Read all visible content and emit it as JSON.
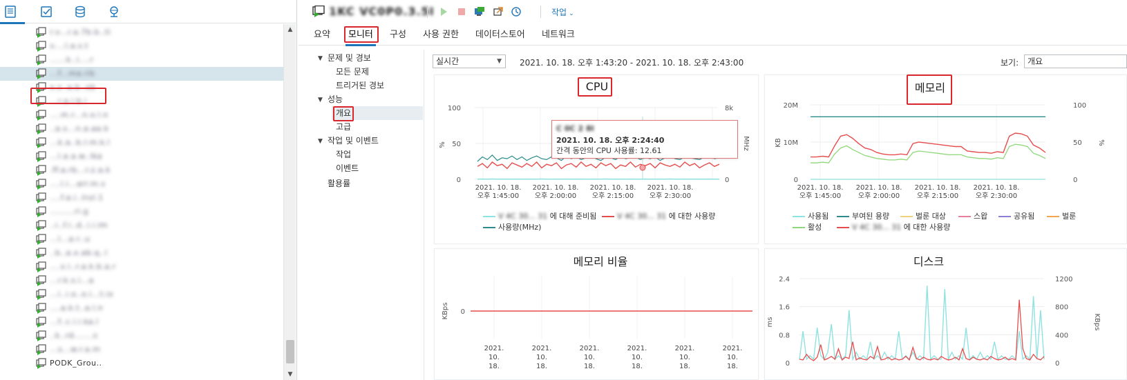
{
  "left_tabs": [
    {
      "name": "hosts-and-clusters",
      "icon": "hosts-clusters-icon"
    },
    {
      "name": "vms-and-templates",
      "icon": "vms-templates-icon"
    },
    {
      "name": "storage",
      "icon": "storage-icon"
    },
    {
      "name": "networking",
      "icon": "networking-icon"
    }
  ],
  "tree": {
    "items": [
      {
        "label": "r.v...r.a.7b.b..ti"
      },
      {
        "label": "v....l.a.s.t"
      },
      {
        "label": "......k..i....r"
      },
      {
        "label": "...f...ma.rik"
      },
      {
        "label": "x.z..a.b..ob"
      },
      {
        "label": "...r.a.i.b.i"
      },
      {
        "label": "....m.r...n.o.l.n"
      },
      {
        "label": "..a.s...n.a.aa.k"
      },
      {
        "label": "...k.a..b.r.m.k.l"
      },
      {
        "label": "...l.a.a.w..lka"
      },
      {
        "label": ".ff.a.rb...r.z.a.k"
      },
      {
        "label": "....l.i...arr.m.s"
      },
      {
        "label": "....f.a.i..lrul.1"
      },
      {
        "label": ".........ri.g"
      },
      {
        "label": "..i..f.i..d..i.i.im"
      },
      {
        "label": "...l...a.r..u"
      },
      {
        "label": "..b..a.x.ab.q..l"
      },
      {
        "label": "....s.i..r.a.k.b.a.r"
      },
      {
        "label": "...r.k.s.i...a"
      },
      {
        "label": "...i..i.o..o.i...t.ix"
      },
      {
        "label": "....a.k.t..a.l.n"
      },
      {
        "label": "...f..c.i.i.ka.l"
      },
      {
        "label": "..k..rd.......s"
      },
      {
        "label": "...s...w.r.a.m"
      },
      {
        "label": "PODK_Grou.."
      }
    ],
    "selected_index": 3
  },
  "header": {
    "vm_name": "1KC VC0P0.3.5I",
    "actions_label": "작업"
  },
  "tabs": [
    "요약",
    "모니터",
    "구성",
    "사용 권한",
    "데이터스토어",
    "네트워크"
  ],
  "active_tab": "모니터",
  "subnav": {
    "issues_label": "문제 및 경보",
    "all_issues": "모든 문제",
    "triggered_alarms": "트리거된 경보",
    "performance_label": "성능",
    "overview": "개요",
    "advanced": "고급",
    "tasks_events_label": "작업 및 이벤트",
    "tasks": "작업",
    "events": "이벤트",
    "utilization": "활용률"
  },
  "range": {
    "mode": "실시간",
    "text": "2021. 10. 18. 오후 1:43:20 - 2021. 10. 18. 오후 2:43:00",
    "view_label": "보기:",
    "view_value": "개요"
  },
  "colors": {
    "accent": "#1b75bb",
    "highlight_red": "#d9262c",
    "series_red": "#e74c4c",
    "series_teal": "#2a8c8c",
    "series_cyan": "#8ee2e0",
    "series_green": "#8fd879",
    "series_pink": "#f4a7b5",
    "series_purple": "#8a7fd6",
    "series_orange": "#f5a64a"
  },
  "tooltip": {
    "line1": "C 0C 2 8I",
    "line2": "2021. 10. 18. 오후 2:24:40",
    "line3": "간격 동안의 CPU 사용률: 12.61"
  },
  "charts": {
    "cpu": {
      "title": "CPU",
      "yleft_label": "%",
      "yright_label": "MHz",
      "yleft_ticks": [
        "100",
        "50",
        "0"
      ],
      "yright_ticks": [
        "8k",
        "4k",
        "0"
      ]
    },
    "memory": {
      "title": "메모리",
      "yleft_label": "KB",
      "yright_label": "%",
      "yleft_ticks": [
        "20M",
        "10M",
        "0"
      ],
      "yright_ticks": [
        "100",
        "50",
        "0"
      ]
    },
    "mem_rate": {
      "title": "메모리 비율",
      "yleft_label": "KBps",
      "yleft_ticks": [
        "0"
      ]
    },
    "disk": {
      "title": "디스크",
      "yleft_label": "ms",
      "yright_label": "KBps",
      "yleft_ticks": [
        "2.4",
        "1.6",
        "0.8",
        "0"
      ],
      "yright_ticks": [
        "1200",
        "800",
        "400",
        "0"
      ]
    }
  },
  "time_labels": [
    {
      "date": "2021. 10. 18.",
      "time": "오후 1:45:00"
    },
    {
      "date": "2021. 10. 18.",
      "time": "오후 2:00:00"
    },
    {
      "date": "2021. 10. 18.",
      "time": "오후 2:15:00"
    },
    {
      "date": "2021. 10. 18.",
      "time": "오후 2:30:00"
    }
  ],
  "bottom_time_labels": [
    "2021.",
    "10.",
    "18."
  ],
  "legend": {
    "cpu": [
      {
        "label": "V 4C 30... 31 에 대해 준비됨",
        "blur": "V 4C 30... 31",
        "suffix": "에 대해 준비됨",
        "color": "#8ee2e0"
      },
      {
        "label": "V 4C 30... 31 에 대한 사용량",
        "blur": "V 4C 30... 31",
        "suffix": "에 대한 사용량",
        "color": "#e74c4c"
      },
      {
        "label": "사용량(MHz)",
        "blur": "",
        "suffix": "사용량(MHz)",
        "color": "#2a8c8c"
      }
    ],
    "memory": [
      {
        "label": "사용됨",
        "color": "#8ee2e0"
      },
      {
        "label": "부여된 용량",
        "color": "#2a8c8c"
      },
      {
        "label": "벌룬 대상",
        "color": "#f0d278"
      },
      {
        "label": "스왑",
        "color": "#e87f9a"
      },
      {
        "label": "공유됨",
        "color": "#8a7fd6"
      },
      {
        "label": "벌룬",
        "color": "#f5a64a"
      },
      {
        "label": "활성",
        "color": "#8fd879"
      },
      {
        "label": "V 4C 30... 31 에 대한 사용량",
        "blur": "V 4C 30... 31",
        "suffix": "에 대한 사용량",
        "color": "#e74c4c"
      }
    ]
  },
  "chart_data": [
    {
      "type": "line",
      "title": "CPU",
      "xlabel": "",
      "ylabel": "%",
      "ylim": [
        0,
        100
      ],
      "y2label": "MHz",
      "y2lim": [
        0,
        8000
      ],
      "x_ticks": [
        "2021. 10. 18. 오후 1:45:00",
        "2021. 10. 18. 오후 2:00:00",
        "2021. 10. 18. 오후 2:15:00",
        "2021. 10. 18. 오후 2:30:00"
      ],
      "series": [
        {
          "name": "사용량(MHz)",
          "axis": "right",
          "approx_range": [
            1800,
            2700
          ],
          "values": [
            2000,
            2500,
            2200,
            2700,
            2100,
            2400,
            2300,
            2600,
            2200,
            2500,
            2100,
            2400,
            2600,
            2300,
            2200,
            2500,
            2400,
            2100,
            2600,
            2300,
            2500,
            2200,
            2400,
            2700,
            2300,
            2100,
            2500,
            2400,
            2200,
            2600,
            2300,
            2400,
            2500,
            2200,
            2400,
            2300,
            2500,
            2100,
            2400,
            2600,
            2300,
            2200,
            2500,
            2400,
            2300,
            2200,
            2500,
            2600,
            2300,
            2400
          ]
        },
        {
          "name": "V 4C 30... 31 에 대한 사용량",
          "axis": "left",
          "approx_range": [
            12,
            30
          ],
          "values": [
            18,
            22,
            16,
            24,
            19,
            21,
            15,
            23,
            20,
            17,
            22,
            18,
            24,
            16,
            21,
            19,
            23,
            15,
            20,
            22,
            17,
            24,
            18,
            21,
            16,
            23,
            19,
            22,
            15,
            20,
            18,
            24,
            17,
            21,
            19,
            22,
            16,
            23,
            20,
            18,
            21,
            17,
            24,
            19,
            22,
            16,
            20,
            23,
            18,
            21
          ]
        },
        {
          "name": "V 4C 30... 31 에 대해 준비됨",
          "axis": "left",
          "approx_range": [
            0,
            1
          ],
          "values": [
            0.3,
            0.4,
            0.2,
            0.5,
            0.3,
            0.4,
            0.2,
            0.3,
            0.4,
            0.3,
            0.2,
            0.4,
            0.3,
            0.5,
            0.3,
            0.2,
            0.4,
            0.3,
            0.4,
            0.2,
            0.3,
            0.4,
            0.3,
            0.2,
            0.4,
            0.3,
            0.5,
            0.3,
            0.2,
            0.4,
            0.3,
            0.4,
            0.2,
            0.3,
            0.4,
            0.3,
            0.2,
            0.4,
            0.3,
            0.5,
            0.3,
            0.2,
            0.4,
            0.3,
            0.4,
            0.2,
            0.3,
            0.4,
            0.3,
            0.2
          ]
        }
      ]
    },
    {
      "type": "line",
      "title": "메모리",
      "xlabel": "",
      "ylabel": "KB",
      "ylim": [
        0,
        20000000
      ],
      "y2label": "%",
      "y2lim": [
        0,
        100
      ],
      "x_ticks": [
        "2021. 10. 18. 오후 1:45:00",
        "2021. 10. 18. 오후 2:00:00",
        "2021. 10. 18. 오후 2:15:00",
        "2021. 10. 18. 오후 2:30:00"
      ],
      "series": [
        {
          "name": "부여된 용량",
          "axis": "left",
          "values": [
            16800000,
            16800000,
            16800000,
            16800000,
            16800000,
            16800000,
            16800000,
            16800000,
            16800000,
            16800000,
            16800000,
            16800000,
            16800000,
            16800000,
            16800000,
            16800000,
            16800000,
            16800000,
            16800000,
            16800000,
            16800000,
            16800000,
            16800000,
            16800000,
            16800000,
            16800000,
            16800000,
            16800000,
            16800000,
            16800000,
            16800000,
            16800000,
            16800000,
            16800000,
            16800000,
            16800000,
            16800000,
            16800000,
            16800000,
            16800000
          ]
        },
        {
          "name": "V 4C 30... 31 에 대한 사용량",
          "axis": "right",
          "values": [
            30,
            30,
            31,
            30,
            45,
            58,
            60,
            55,
            48,
            42,
            40,
            36,
            34,
            33,
            33,
            34,
            33,
            48,
            50,
            49,
            48,
            47,
            46,
            45,
            44,
            44,
            38,
            37,
            36,
            36,
            35,
            37,
            36,
            58,
            62,
            61,
            58,
            46,
            42,
            36
          ]
        },
        {
          "name": "활성",
          "axis": "right",
          "values": [
            22,
            22,
            23,
            22,
            34,
            42,
            45,
            40,
            36,
            32,
            30,
            28,
            27,
            26,
            26,
            27,
            26,
            36,
            38,
            37,
            36,
            35,
            34,
            33,
            33,
            33,
            30,
            29,
            28,
            28,
            27,
            29,
            28,
            44,
            47,
            46,
            44,
            35,
            32,
            28
          ]
        },
        {
          "name": "사용됨",
          "axis": "right",
          "values": [
            0,
            0,
            0,
            0,
            0,
            0,
            0,
            0,
            0,
            0,
            0,
            0,
            0,
            0,
            0,
            0,
            0,
            0,
            0,
            0,
            0,
            0,
            0,
            0,
            0,
            0,
            0,
            0,
            0,
            0,
            0,
            0,
            0,
            0,
            0,
            0,
            0,
            0,
            0,
            0
          ]
        }
      ]
    },
    {
      "type": "line",
      "title": "메모리 비율",
      "ylabel": "KBps",
      "y_ticks": [
        "0"
      ],
      "x_ticks": [
        "2021. 10.",
        "2021. 10.",
        "2021. 10.",
        "2021. 10.",
        "2021. 10.",
        "2021. 10."
      ],
      "series": [
        {
          "name": "V 4C 30... 31 에 대한 사용량",
          "values": [
            0,
            0,
            0,
            0,
            0,
            0,
            0,
            0,
            0,
            0,
            0,
            0,
            0,
            0,
            0,
            0,
            0,
            0,
            0,
            0
          ]
        }
      ]
    },
    {
      "type": "line",
      "title": "디스크",
      "ylabel": "ms",
      "ylim": [
        0,
        2.4
      ],
      "y2label": "KBps",
      "y2lim": [
        0,
        1200
      ],
      "x_ticks": [
        "2021. 10.",
        "2021. 10.",
        "2021. 10.",
        "2021. 10.",
        "2021. 10.",
        "2021. 10."
      ],
      "series": [
        {
          "name": "cyan",
          "axis": "left",
          "values": [
            0.1,
            0.9,
            0.1,
            0.2,
            0.1,
            1.0,
            0.2,
            0.1,
            0.3,
            1.1,
            0.1,
            0.2,
            0.1,
            0.2,
            1.5,
            0.1,
            0.3,
            0.1,
            0.2,
            0.1,
            0.6,
            0.1,
            0.2,
            0.1,
            0.3,
            0.1,
            0.2,
            0.1,
            0.9,
            0.1,
            0.2,
            0.1,
            0.3,
            0.1,
            0.2,
            0.1,
            2.2,
            0.1,
            0.2,
            0.1,
            0.1,
            2.1,
            0.1,
            0.3,
            0.1,
            0.2,
            0.1,
            1.0,
            0.1,
            0.2,
            0.1,
            0.3,
            0.1,
            0.2,
            0.1,
            0.6,
            0.1,
            0.2,
            0.1,
            0.1,
            0.2,
            0.1,
            0.9,
            0.1,
            0.2,
            0.1,
            1.9,
            0.1,
            1.5,
            0.1
          ]
        },
        {
          "name": "red",
          "axis": "right",
          "values": [
            50,
            40,
            120,
            60,
            30,
            80,
            260,
            40,
            60,
            90,
            50,
            200,
            40,
            80,
            60,
            300,
            40,
            70,
            50,
            40,
            90,
            60,
            230,
            40,
            50,
            80,
            40,
            60,
            40,
            50,
            90,
            40,
            220,
            60,
            40,
            80,
            50,
            40,
            60,
            40,
            90,
            60,
            40,
            50,
            80,
            40,
            200,
            60,
            40,
            80,
            50,
            40,
            60,
            40,
            90,
            60,
            40,
            50,
            80,
            40,
            60,
            40,
            900,
            200,
            60,
            40,
            120,
            60,
            40,
            90
          ]
        }
      ]
    }
  ]
}
